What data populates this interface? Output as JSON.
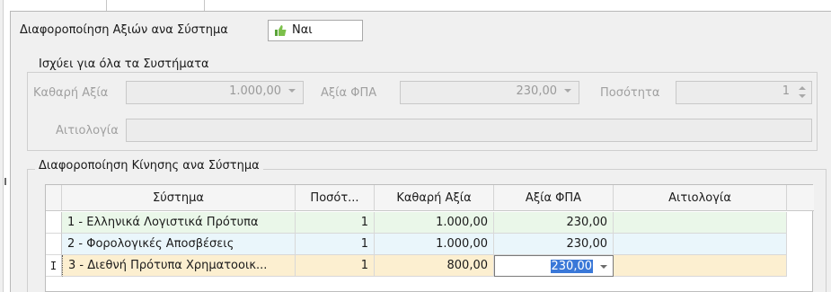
{
  "diff_values": {
    "label": "Διαφοροποίηση Αξιών ανα Σύστημα",
    "value": "Ναι"
  },
  "all_systems": {
    "legend": "Ισχύει για όλα τα Συστήματα",
    "net_value_label": "Καθαρή Αξία",
    "net_value": "1.000,00",
    "vat_value_label": "Αξία ΦΠΑ",
    "vat_value": "230,00",
    "quantity_label": "Ποσότητα",
    "quantity": "1",
    "reason_label": "Αιτιολογία",
    "reason": ""
  },
  "movement": {
    "legend": "Διαφοροποίηση Κίνησης ανα Σύστημα",
    "columns": [
      "Σύστημα",
      "Ποσότ...",
      "Καθαρή Αξία",
      "Αξία ΦΠΑ",
      "Αιτιολογία"
    ],
    "rows": [
      {
        "indicator": "",
        "system": "1 - Ελληνικά Λογιστικά Πρότυπα",
        "quantity": "1",
        "net": "1.000,00",
        "vat": "230,00",
        "reason": ""
      },
      {
        "indicator": "",
        "system": "2 - Φορολογικές Αποσβέσεις",
        "quantity": "1",
        "net": "1.000,00",
        "vat": "230,00",
        "reason": ""
      },
      {
        "indicator": "I",
        "system": "3 - Διεθνή Πρότυπα Χρηματοοικ...",
        "quantity": "1",
        "net": "800,00",
        "vat": "230,00",
        "reason": ""
      }
    ]
  },
  "colors": {
    "row1": "#eaf7e9",
    "row2": "#eaf6fb",
    "row3": "#fcefd0",
    "selection": "#3a78d8"
  }
}
